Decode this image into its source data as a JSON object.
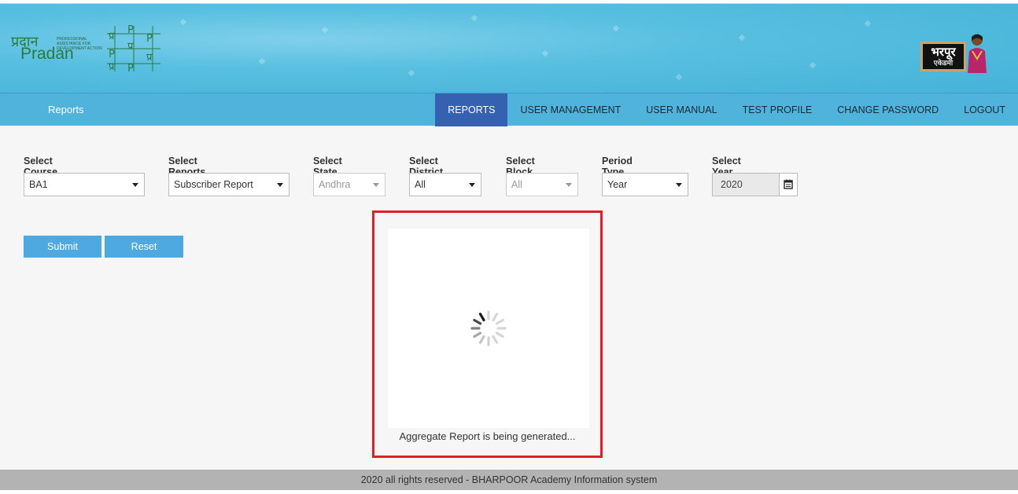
{
  "header": {
    "pradan_logo_hindi": "प्रदान",
    "pradan_logo_text": "Pradan",
    "pradan_tagline": "PROFESSIONAL ASSISTANCE FOR DEVELOPMENT ACTION",
    "grid_letter": "P",
    "grid_letter_hindi": "प्र",
    "bharpoor_logo_hindi": "भरपूर",
    "bharpoor_logo_sub": "एकेडमी"
  },
  "navbar": {
    "brand": "Reports",
    "items": [
      {
        "label": "REPORTS",
        "active": true
      },
      {
        "label": "USER MANAGEMENT",
        "active": false
      },
      {
        "label": "USER MANUAL",
        "active": false
      },
      {
        "label": "TEST PROFILE",
        "active": false
      },
      {
        "label": "CHANGE PASSWORD",
        "active": false
      },
      {
        "label": "LOGOUT",
        "active": false
      }
    ]
  },
  "filters": {
    "course": {
      "label": "Select Course",
      "value": "BA1"
    },
    "reports": {
      "label": "Select Reports",
      "value": "Subscriber Report"
    },
    "state": {
      "label": "Select State",
      "value": "Andhra"
    },
    "district": {
      "label": "Select District",
      "value": "All"
    },
    "block": {
      "label": "Select Block",
      "value": "All"
    },
    "period": {
      "label": "Period Type",
      "value": "Year"
    },
    "year": {
      "label": "Select Year",
      "value": "2020"
    }
  },
  "actions": {
    "submit": "Submit",
    "reset": "Reset"
  },
  "loading_modal": {
    "message": "Aggregate Report is being generated...",
    "highlight_color": "#e01e25"
  },
  "footer": {
    "text": "2020 all rights reserved - BHARPOOR Academy Information system"
  },
  "colors": {
    "banner": "#58bfe0",
    "navbar": "#4fb3dc",
    "nav_active": "#3561b0",
    "button": "#4ea9e0"
  }
}
